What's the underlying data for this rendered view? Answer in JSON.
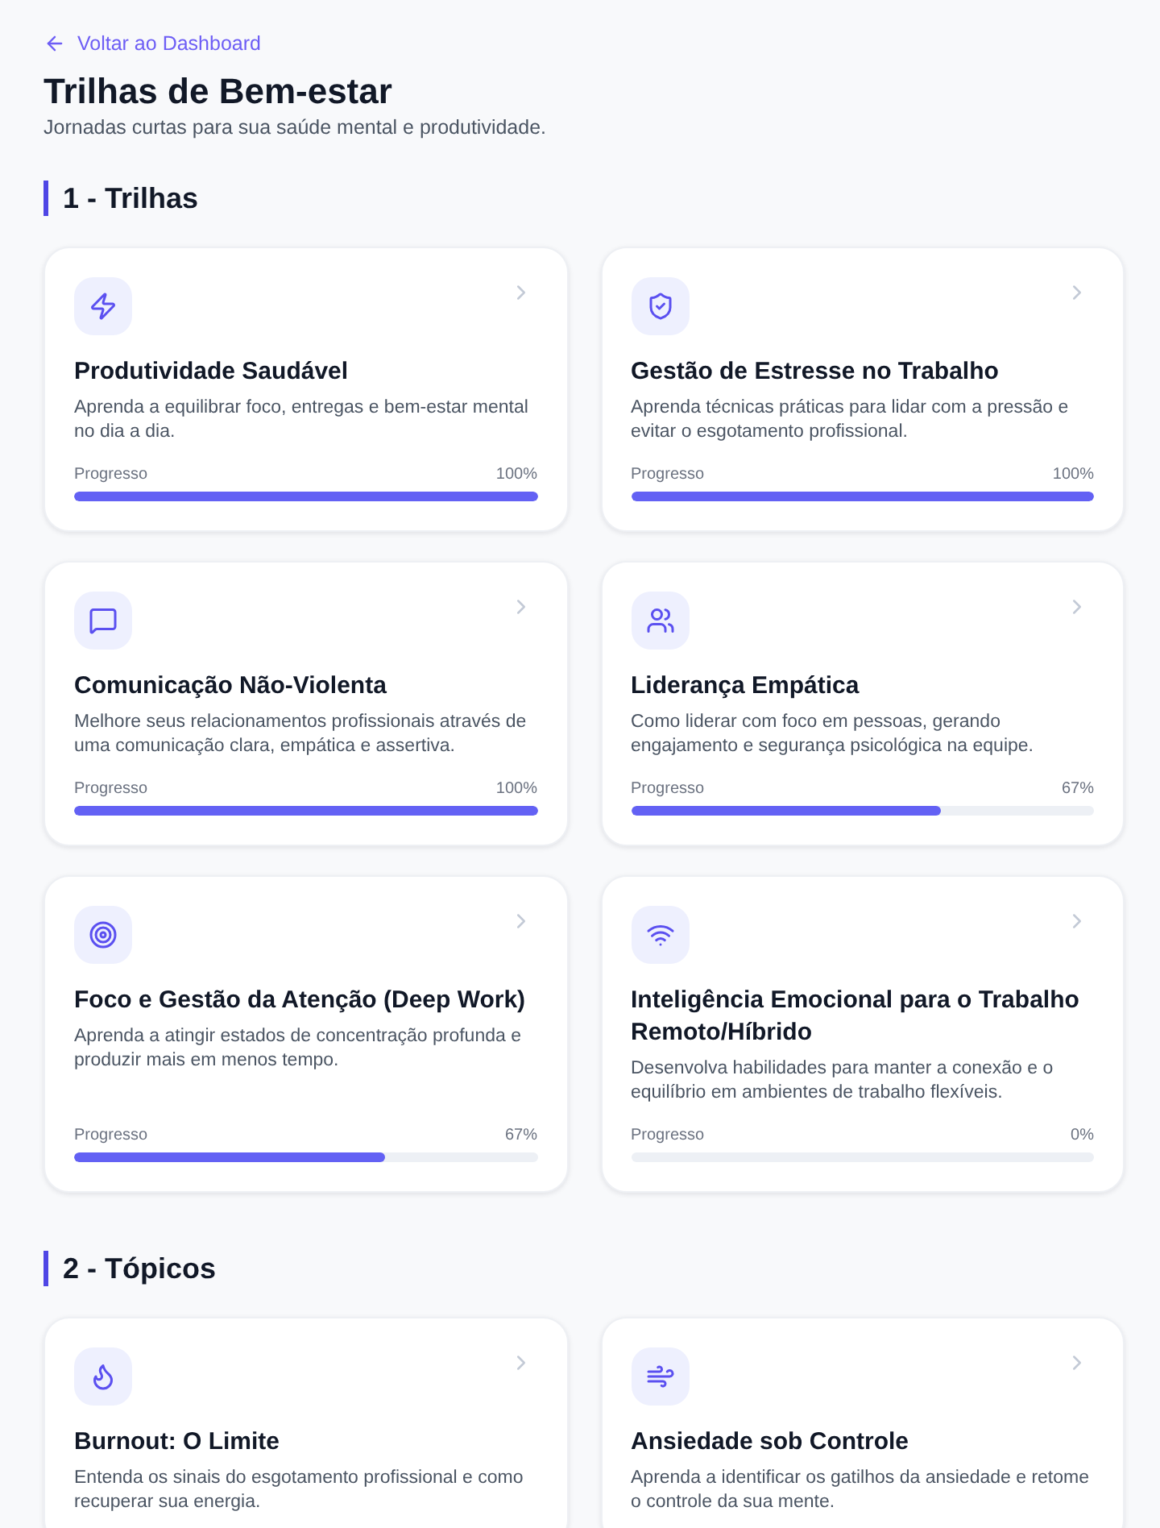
{
  "back_link": {
    "label": "Voltar ao Dashboard"
  },
  "page": {
    "title": "Trilhas de Bem-estar",
    "subtitle": "Jornadas curtas para sua saúde mental e produtividade."
  },
  "sections": [
    {
      "heading": "1 - Trilhas",
      "cards": [
        {
          "title": "Produtividade Saudável",
          "description": "Aprenda a equilibrar foco, entregas e bem-estar mental no dia a dia.",
          "progress_label": "Progresso",
          "percent": "100%",
          "level": 1
        },
        {
          "title": "Gestão de Estresse no Trabalho",
          "description": "Aprenda técnicas práticas para lidar com a pressão e evitar o esgotamento profissional.",
          "progress_label": "Progresso",
          "percent": "100%",
          "level": 1
        },
        {
          "title": "Comunicação Não-Violenta",
          "description": "Melhore seus relacionamentos profissionais através de uma comunicação clara, empática e assertiva.",
          "progress_label": "Progresso",
          "percent": "100%",
          "level": 1
        },
        {
          "title": "Liderança Empática",
          "description": "Como liderar com foco em pessoas, gerando engajamento e segurança psicológica na equipe.",
          "progress_label": "Progresso",
          "percent": "67%",
          "level": 0.67
        },
        {
          "title": "Foco e Gestão da Atenção (Deep Work)",
          "description": "Aprenda a atingir estados de concentração profunda e produzir mais em menos tempo.",
          "progress_label": "Progresso",
          "percent": "67%",
          "level": 0.67
        },
        {
          "title": "Inteligência Emocional para o Trabalho Remoto/Híbrido",
          "description": "Desenvolva habilidades para manter a conexão e o equilíbrio em ambientes de trabalho flexíveis.",
          "progress_label": "Progresso",
          "percent": "0%",
          "level": 0
        }
      ]
    },
    {
      "heading": "2 - Tópicos",
      "cards": [
        {
          "title": "Burnout: O Limite",
          "description": "Entenda os sinais do esgotamento profissional e como recuperar sua energia."
        },
        {
          "title": "Ansiedade sob Controle",
          "description": "Aprenda a identificar os gatilhos da ansiedade e retome o controle da sua mente."
        }
      ]
    }
  ]
}
